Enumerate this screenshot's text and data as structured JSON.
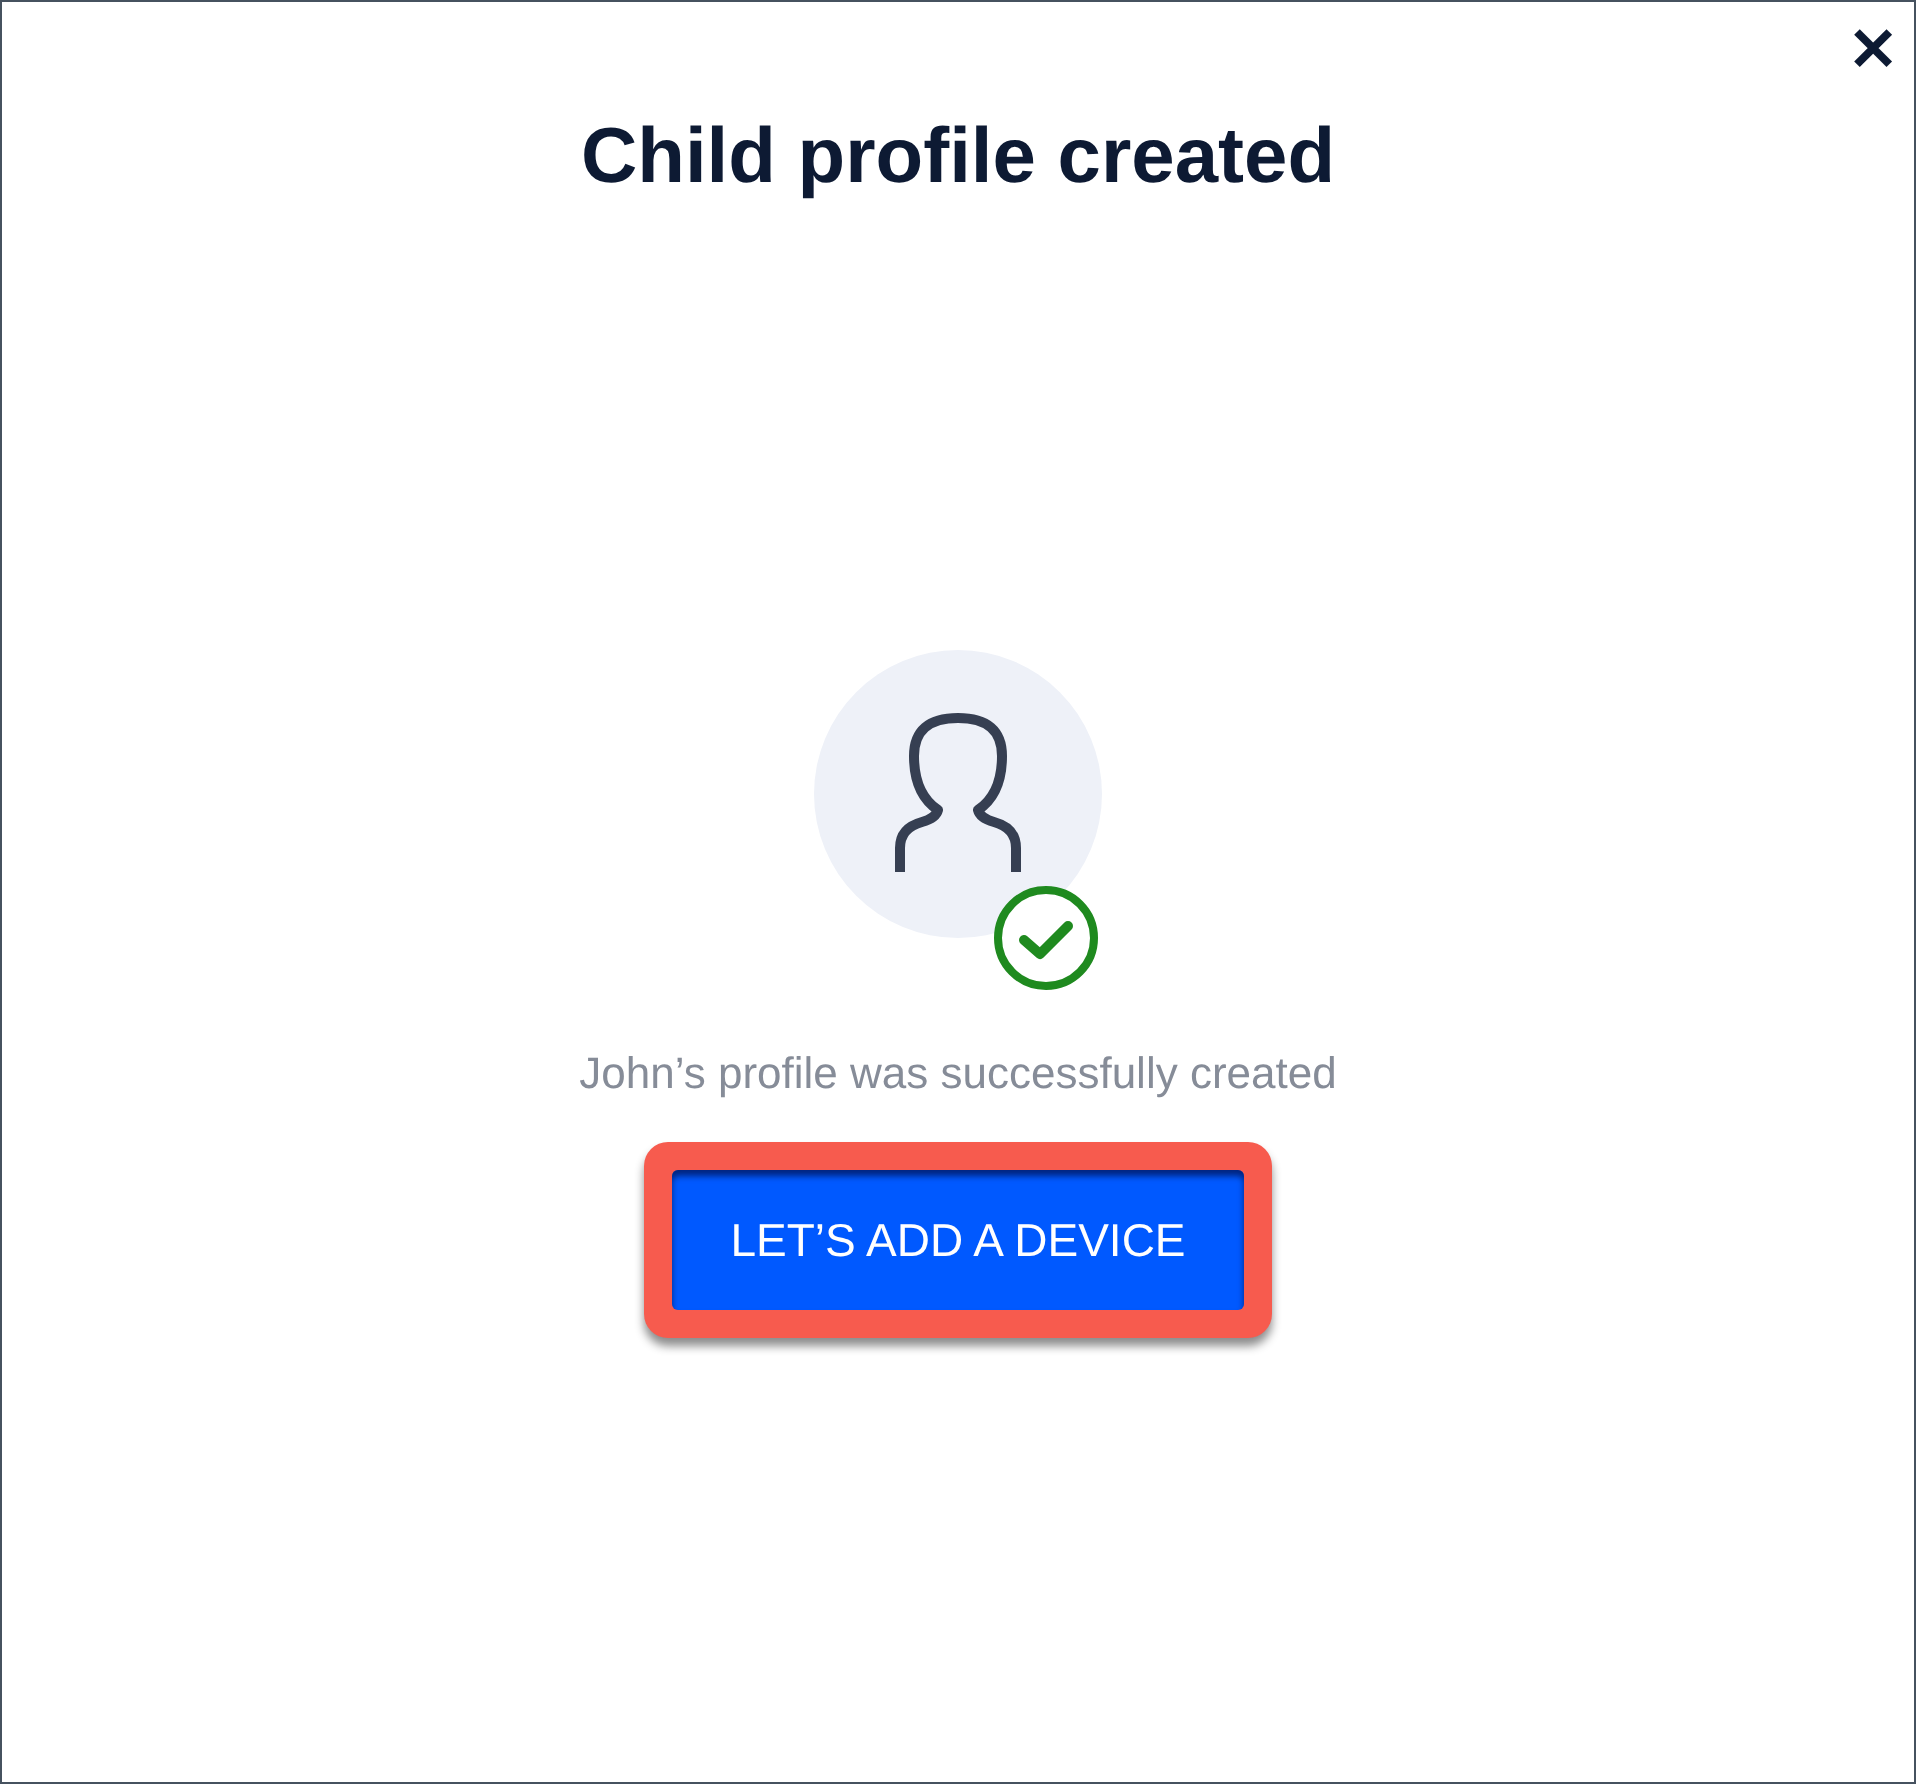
{
  "dialog": {
    "title": "Child profile created",
    "close_label": "✕"
  },
  "message": "John’s profile was successfully created",
  "status": {
    "success": true
  },
  "button": {
    "label": "LET’S ADD A DEVICE",
    "highlighted": true
  }
}
